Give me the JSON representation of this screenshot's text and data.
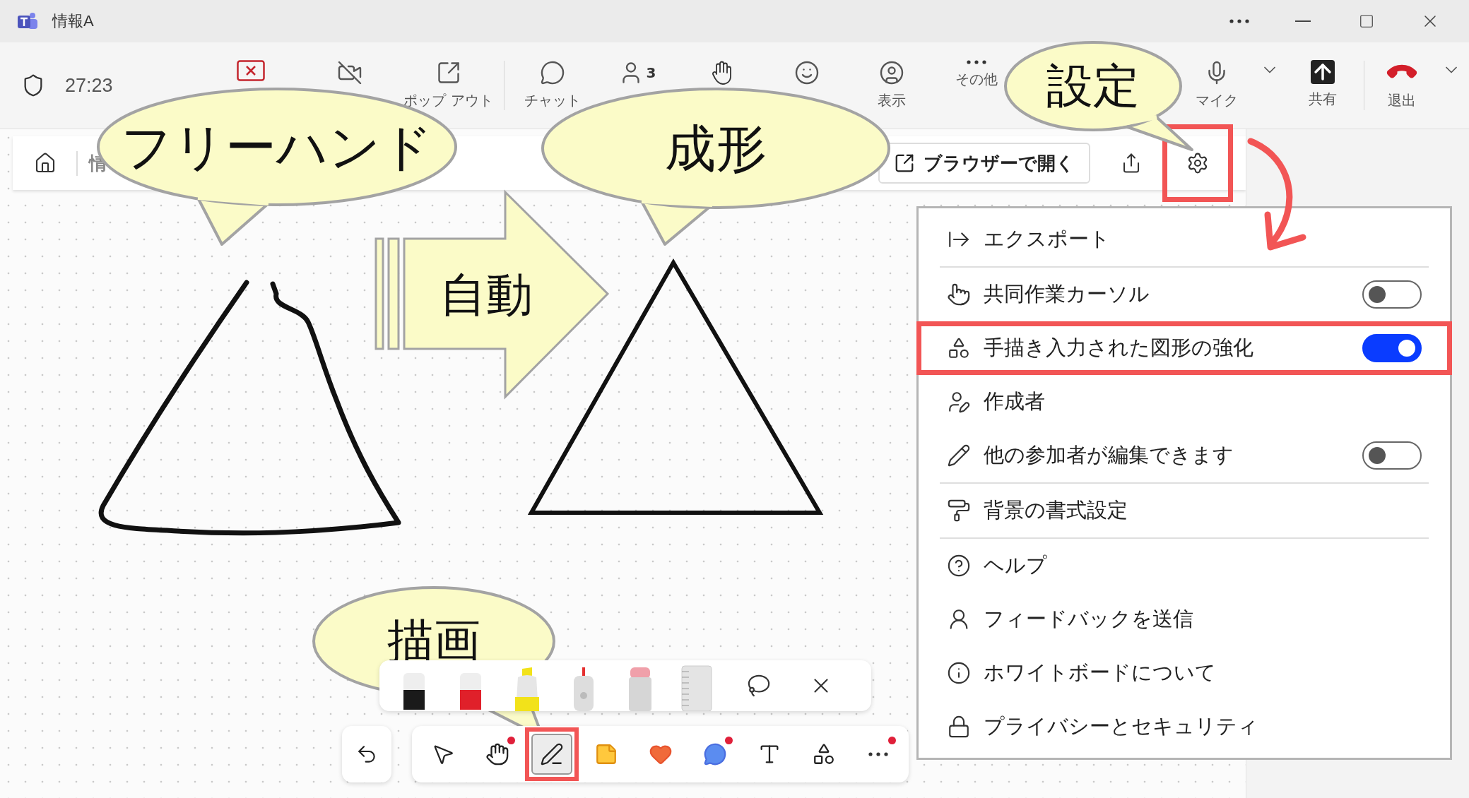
{
  "window": {
    "title": "情報A"
  },
  "meeting_bar": {
    "timer": "27:23",
    "items": [
      {
        "kind": "stop"
      },
      {
        "kind": "camera-off"
      },
      {
        "kind": "popout",
        "label": "ポップ アウト"
      },
      {
        "kind": "separator"
      },
      {
        "kind": "chat",
        "label": "チャット"
      },
      {
        "kind": "people",
        "badge": "3"
      },
      {
        "kind": "hand"
      },
      {
        "kind": "react"
      },
      {
        "kind": "view",
        "label": "表示"
      },
      {
        "kind": "more",
        "label": "その他"
      },
      {
        "kind": "mic",
        "label": "マイク"
      },
      {
        "kind": "chevron"
      },
      {
        "kind": "share",
        "label": "共有"
      },
      {
        "kind": "separator"
      },
      {
        "kind": "leave",
        "label": "退出"
      },
      {
        "kind": "chevron"
      }
    ]
  },
  "whiteboard_bar": {
    "breadcrumb": "情",
    "open_button": "ブラウザーで開く",
    "settings_highlighted": true
  },
  "settings_menu": {
    "sections": [
      [
        {
          "kind": "export",
          "label": "エクスポート",
          "highlighted": false
        }
      ],
      [
        {
          "kind": "cursor",
          "label": "共同作業カーソル",
          "on": false,
          "highlighted": false
        },
        {
          "kind": "shapes",
          "label": "手描き入力された図形の強化",
          "on": true,
          "highlighted": true
        },
        {
          "kind": "author",
          "label": "作成者",
          "highlighted": false
        },
        {
          "kind": "edit",
          "label": "他の参加者が編集できます",
          "on": false,
          "highlighted": false
        }
      ],
      [
        {
          "kind": "background",
          "label": "背景の書式設定",
          "highlighted": false
        }
      ],
      [
        {
          "kind": "help",
          "label": "ヘルプ",
          "highlighted": false
        },
        {
          "kind": "feedback",
          "label": "フィードバックを送信",
          "highlighted": false
        },
        {
          "kind": "about",
          "label": "ホワイトボードについて",
          "highlighted": false
        },
        {
          "kind": "privacy",
          "label": "プライバシーとセキュリティ",
          "highlighted": false
        }
      ]
    ]
  },
  "pen_tray": [
    {
      "kind": "pen",
      "color": "#1a1a1a"
    },
    {
      "kind": "pen",
      "color": "#e0202a"
    },
    {
      "kind": "highlighter",
      "color": "#f2e21a"
    },
    {
      "kind": "laser",
      "color": "#e53030"
    },
    {
      "kind": "eraser",
      "color": "#f0a0aa"
    },
    {
      "kind": "ruler"
    },
    {
      "kind": "lasso"
    },
    {
      "kind": "close"
    }
  ],
  "tools": [
    {
      "kind": "select",
      "selected": false,
      "dot": false,
      "highlighted": false
    },
    {
      "kind": "hand",
      "selected": false,
      "dot": true,
      "highlighted": false
    },
    {
      "kind": "pen",
      "selected": true,
      "dot": false,
      "highlighted": true
    },
    {
      "kind": "note",
      "selected": false,
      "dot": false,
      "highlighted": false
    },
    {
      "kind": "reaction",
      "selected": false,
      "dot": false,
      "highlighted": false
    },
    {
      "kind": "comment",
      "selected": false,
      "dot": true,
      "highlighted": false
    },
    {
      "kind": "text",
      "selected": false,
      "dot": false,
      "highlighted": false
    },
    {
      "kind": "shapes",
      "selected": false,
      "dot": false,
      "highlighted": false
    },
    {
      "kind": "more",
      "selected": false,
      "dot": true,
      "highlighted": false
    }
  ],
  "annotations": {
    "callouts": [
      {
        "kind": "freehand",
        "text": "フリーハンド"
      },
      {
        "kind": "shaped",
        "text": "成形"
      },
      {
        "kind": "settings",
        "text": "設定"
      },
      {
        "kind": "draw",
        "text": "描画"
      }
    ],
    "arrow_label": "自動"
  }
}
